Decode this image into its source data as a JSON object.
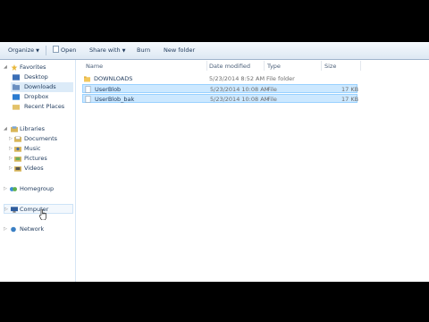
{
  "toolbar": {
    "organize": "Organize",
    "open": "Open",
    "share_with": "Share with",
    "burn": "Burn",
    "new_folder": "New folder"
  },
  "nav": {
    "favorites": "Favorites",
    "desktop": "Desktop",
    "downloads": "Downloads",
    "dropbox": "Dropbox",
    "recent_places": "Recent Places",
    "libraries": "Libraries",
    "documents": "Documents",
    "music": "Music",
    "pictures": "Pictures",
    "videos": "Videos",
    "homegroup": "Homegroup",
    "computer": "Computer",
    "network": "Network"
  },
  "columns": {
    "name": "Name",
    "date_modified": "Date modified",
    "type": "Type",
    "size": "Size"
  },
  "files": [
    {
      "name": "DOWNLOADS",
      "date": "5/23/2014 8:52 AM",
      "type": "File folder",
      "size": ""
    },
    {
      "name": "UserBlob",
      "date": "5/23/2014 10:08 AM",
      "type": "File",
      "size": "17 KB"
    },
    {
      "name": "UserBlob_bak",
      "date": "5/23/2014 10:08 AM",
      "type": "File",
      "size": "17 KB"
    }
  ],
  "colors": {
    "selection": "#cce8ff",
    "selection_border": "#99d1ff",
    "folder": "#f2c75c"
  }
}
